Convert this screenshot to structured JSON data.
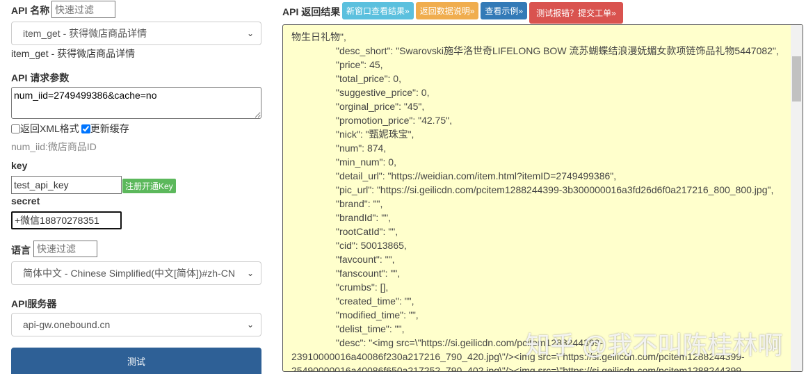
{
  "left": {
    "api_name_label": "API 名称",
    "filter_placeholder": "快速过滤",
    "api_select": "item_get - 获得微店商品详情",
    "api_desc": "item_get - 获得微店商品详情",
    "params_label": "API 请求参数",
    "params_value": "num_iid=2749499386&cache=no",
    "xml_label": "返回XML格式",
    "cache_label": "更新缓存",
    "param_hint": "num_iid:微店商品ID",
    "key_label": "key",
    "key_value": "test_api_key",
    "register_button": "注册开通Key",
    "secret_label": "secret",
    "secret_value": "+微信18870278351",
    "lang_label": "语言",
    "lang_select": "简体中文 - Chinese Simplified(中文[简体])#zh-CN",
    "server_label": "API服务器",
    "server_select": "api-gw.onebound.cn",
    "test_button": "测试"
  },
  "right": {
    "title": "API 返回结果",
    "buttons": [
      {
        "label": "新窗口查看结果»",
        "color": "#5bc0de"
      },
      {
        "label": "返回数据说明»",
        "color": "#f0ad4e"
      },
      {
        "label": "查看示例»",
        "color": "#337ab7"
      },
      {
        "label": "测试报错？提交工单»",
        "color": "#d9534f"
      }
    ],
    "lines": [
      "物生日礼物\",",
      "\"desc_short\": \"Swarovski施华洛世奇LIFELONG BOW 流苏蝴蝶结浪漫妩媚女款项链饰品礼物5447082\",",
      "\"price\": 45,",
      "\"total_price\": 0,",
      "\"suggestive_price\": 0,",
      "\"orginal_price\": \"45\",",
      "\"promotion_price\": \"42.75\",",
      "\"nick\": \"甄妮珠宝\",",
      "\"num\": 874,",
      "\"min_num\": 0,",
      "\"detail_url\": \"https://weidian.com/item.html?itemID=2749499386\",",
      "\"pic_url\": \"https://si.geilicdn.com/pcitem1288244399-3b300000016a3fd26d6f0a217216_800_800.jpg\",",
      "\"brand\": \"\",",
      "\"brandId\": \"\",",
      "\"rootCatId\": \"\",",
      "\"cid\": 50013865,",
      "\"favcount\": \"\",",
      "\"fanscount\": \"\",",
      "\"crumbs\": [],",
      "\"created_time\": \"\",",
      "\"modified_time\": \"\",",
      "\"delist_time\": \"\",",
      "\"desc\": \"<img src=\\\"https://si.geilicdn.com/pcitem1288244399-",
      "23910000016a40086f230a217216_790_420.jpg\\\"/><img src=\\\"https://si.geilicdn.com/pcitem1288244399-",
      "25490000016a40086f650a217252_790_402.jpg\\\"/><img src=\\\"https://si.geilicdn.com/pcitem1288244399-"
    ],
    "watermark": "知乎 @我不叫陈桂林啊"
  }
}
